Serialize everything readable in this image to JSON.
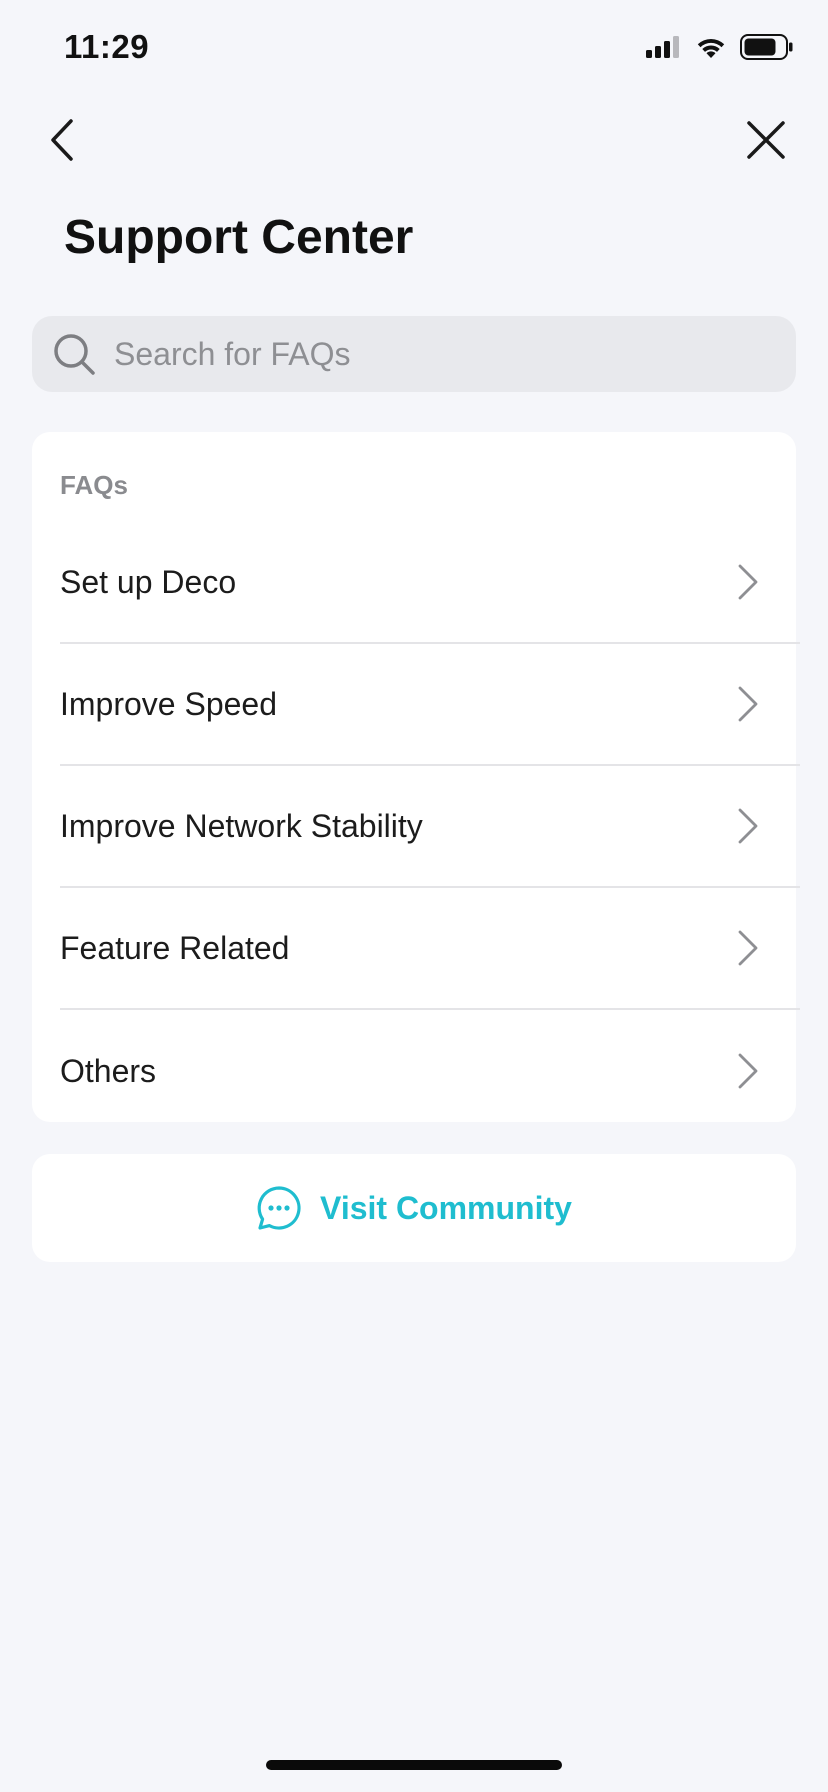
{
  "status_bar": {
    "time": "11:29"
  },
  "header": {
    "title": "Support Center"
  },
  "search": {
    "placeholder": "Search for FAQs",
    "value": ""
  },
  "faqs": {
    "header": "FAQs",
    "items": [
      {
        "label": "Set up Deco"
      },
      {
        "label": "Improve Speed"
      },
      {
        "label": "Improve Network Stability"
      },
      {
        "label": "Feature Related"
      },
      {
        "label": "Others"
      }
    ]
  },
  "community": {
    "label": "Visit Community"
  },
  "colors": {
    "accent": "#1fbdcf",
    "background": "#f5f6fa",
    "card": "#ffffff",
    "search_bg": "#e8e9ed"
  },
  "icons": {
    "back": "chevron-left-icon",
    "close": "close-icon",
    "search": "search-icon",
    "item_chevron": "chevron-right-icon",
    "community": "chat-bubble-icon"
  }
}
